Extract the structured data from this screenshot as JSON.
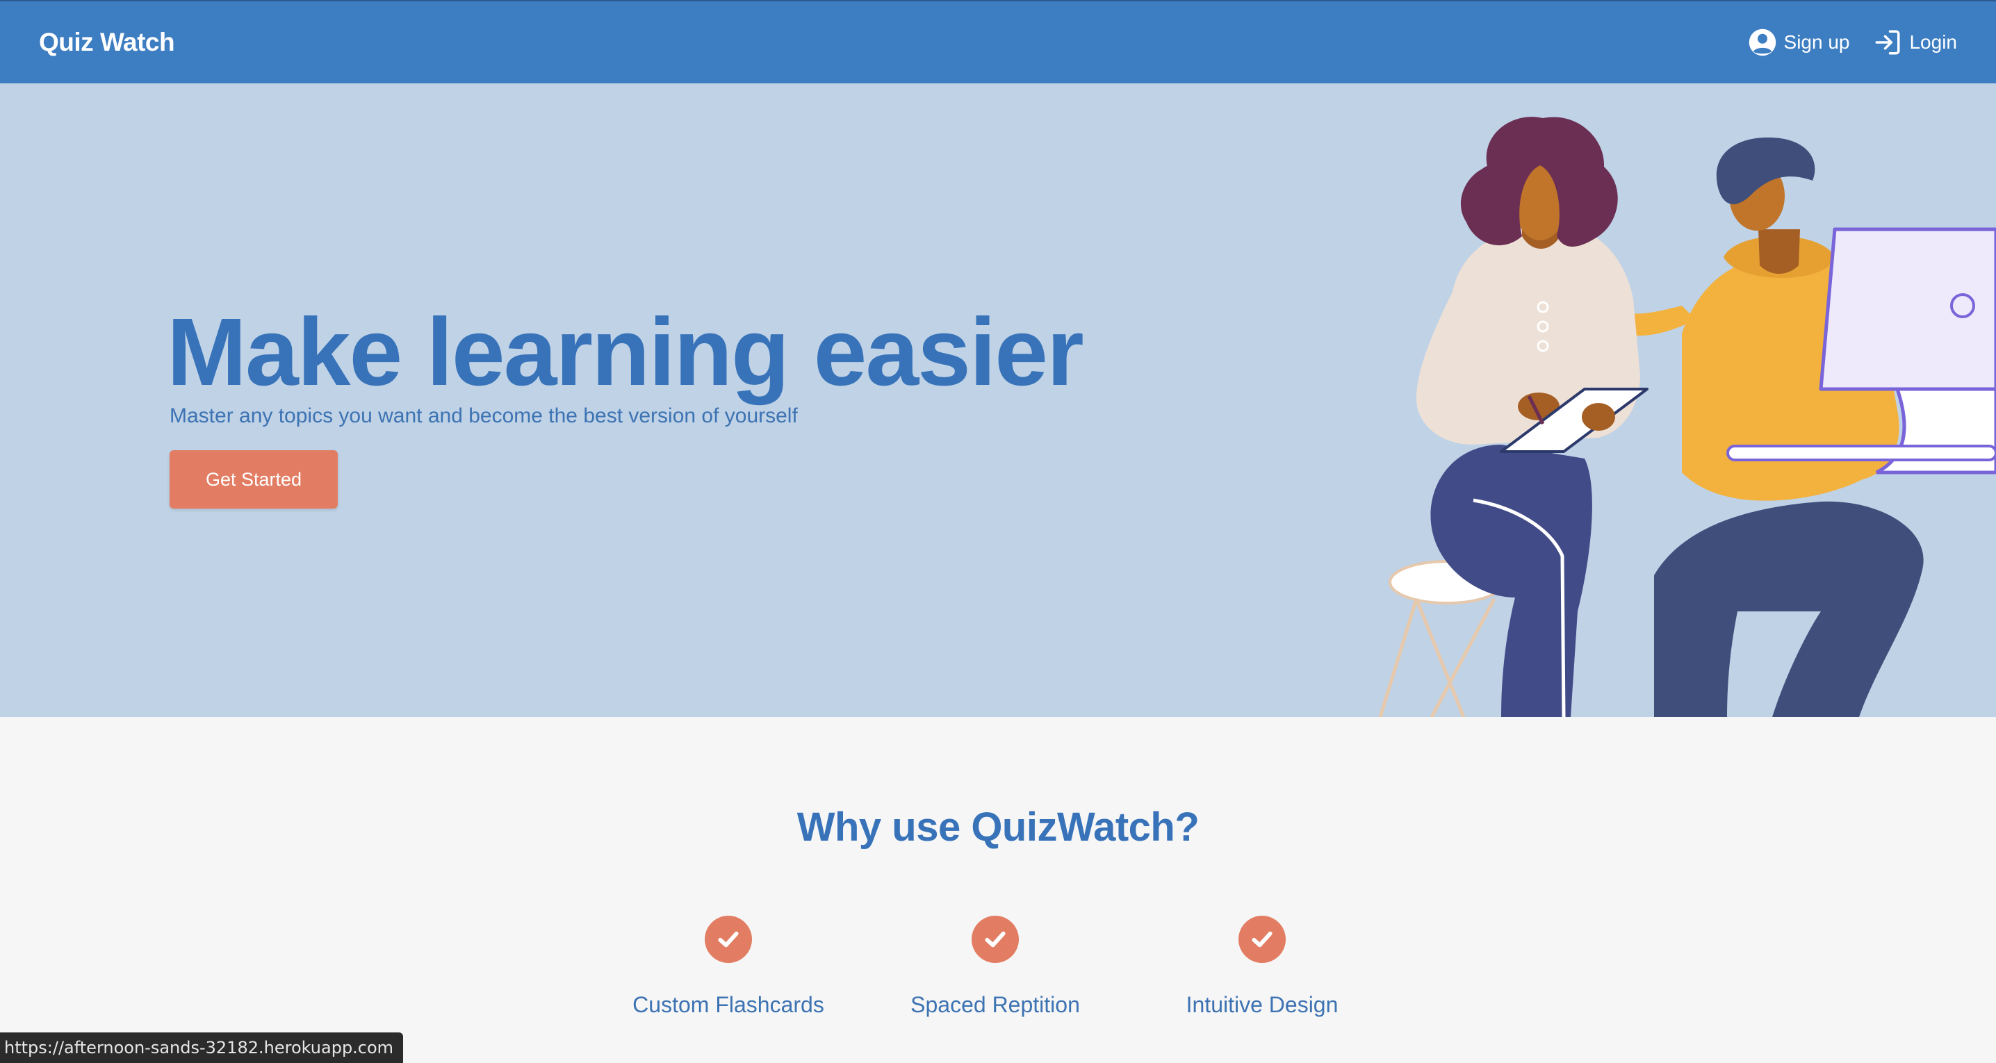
{
  "navbar": {
    "brand": "Quiz Watch",
    "signup_label": "Sign up",
    "login_label": "Login"
  },
  "hero": {
    "title": "Make learning easier",
    "subtitle": "Master any topics you want and become the best version of yourself",
    "cta_label": "Get Started"
  },
  "features": {
    "heading": "Why use QuizWatch?",
    "items": [
      {
        "label": "Custom Flashcards",
        "icon": "check-icon"
      },
      {
        "label": "Spaced Reptition",
        "icon": "check-icon"
      },
      {
        "label": "Intuitive Design",
        "icon": "check-icon"
      }
    ]
  },
  "status_bar": {
    "url": "https://afternoon-sands-32182.herokuapp.com"
  },
  "colors": {
    "navbar": "#3d7dc1",
    "hero_bg": "#bfd2e6",
    "primary_text": "#3873b9",
    "accent": "#e27d63",
    "page_bg": "#f6f6f6"
  }
}
